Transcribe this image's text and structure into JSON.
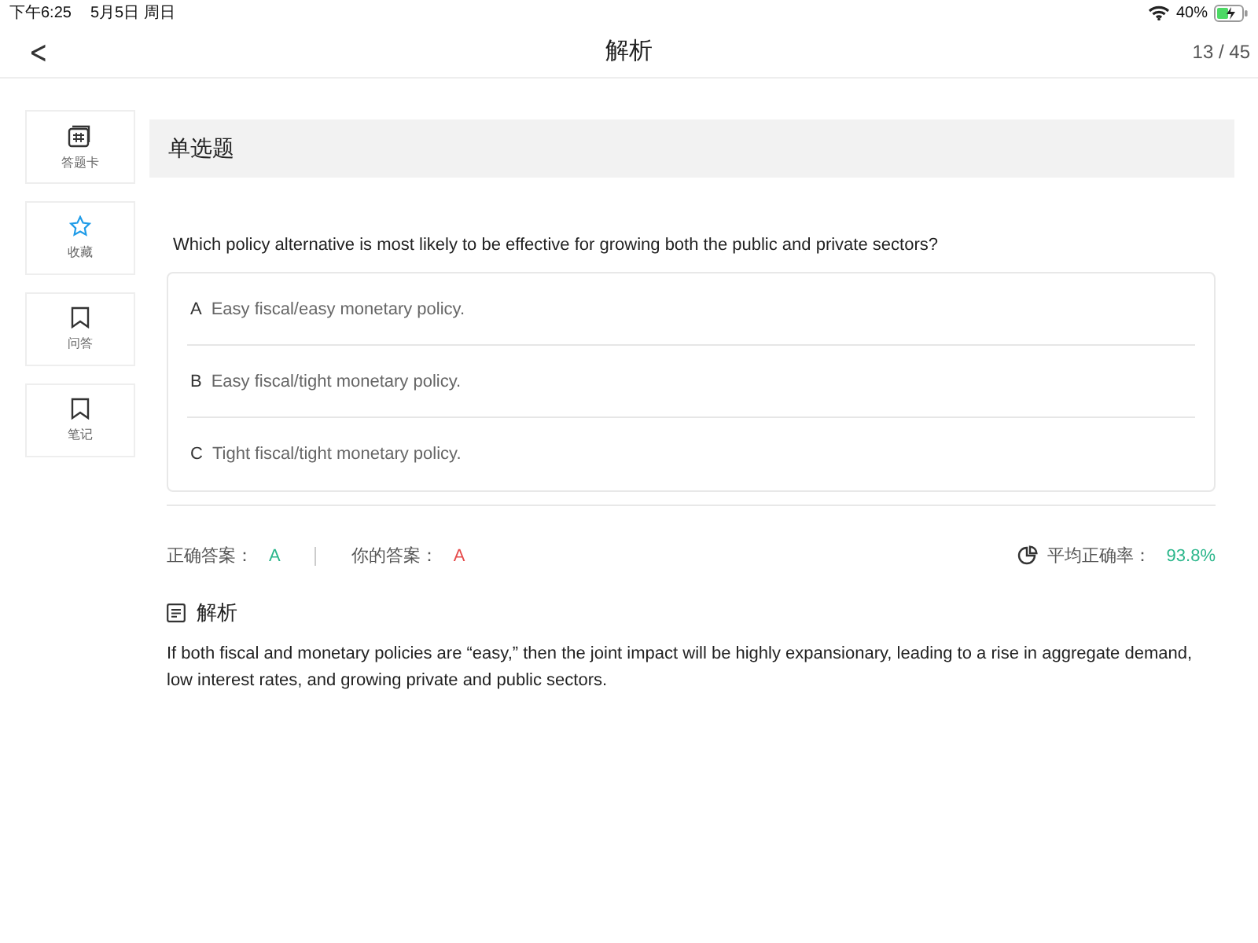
{
  "status_bar": {
    "time": "下午6:25",
    "date": "5月5日 周日",
    "battery": "40%"
  },
  "nav": {
    "back": "<",
    "title": "解析",
    "progress": "13 / 45"
  },
  "sidebar": {
    "items": [
      {
        "kind": "card",
        "label": "答题卡",
        "on": false
      },
      {
        "kind": "star",
        "label": "收藏",
        "on": true
      },
      {
        "kind": "bookmark",
        "label": "问答",
        "on": false
      },
      {
        "kind": "bookmark",
        "label": "笔记",
        "on": false
      }
    ]
  },
  "section": {
    "title": "单选题"
  },
  "question": {
    "text": "Which policy alternative is most likely to be effective for growing both the public and private sectors?",
    "options": [
      {
        "letter": "A",
        "text": "Easy fiscal/easy monetary policy."
      },
      {
        "letter": "B",
        "text": "Easy fiscal/tight monetary policy."
      },
      {
        "letter": "C",
        "text": "Tight fiscal/tight monetary policy."
      }
    ]
  },
  "answers": {
    "correct_label": "正确答案：",
    "correct": "A",
    "yours_label": "你的答案：",
    "yours": "A",
    "your_correct": false,
    "rate_label": "平均正确率：",
    "rate": "93.8%"
  },
  "analysis": {
    "title": "解析",
    "text": "If both fiscal and monetary policies are “easy,” then the joint impact will be highly expansionary, leading to a rise in aggregate demand, low interest rates, and growing private and public sectors."
  }
}
